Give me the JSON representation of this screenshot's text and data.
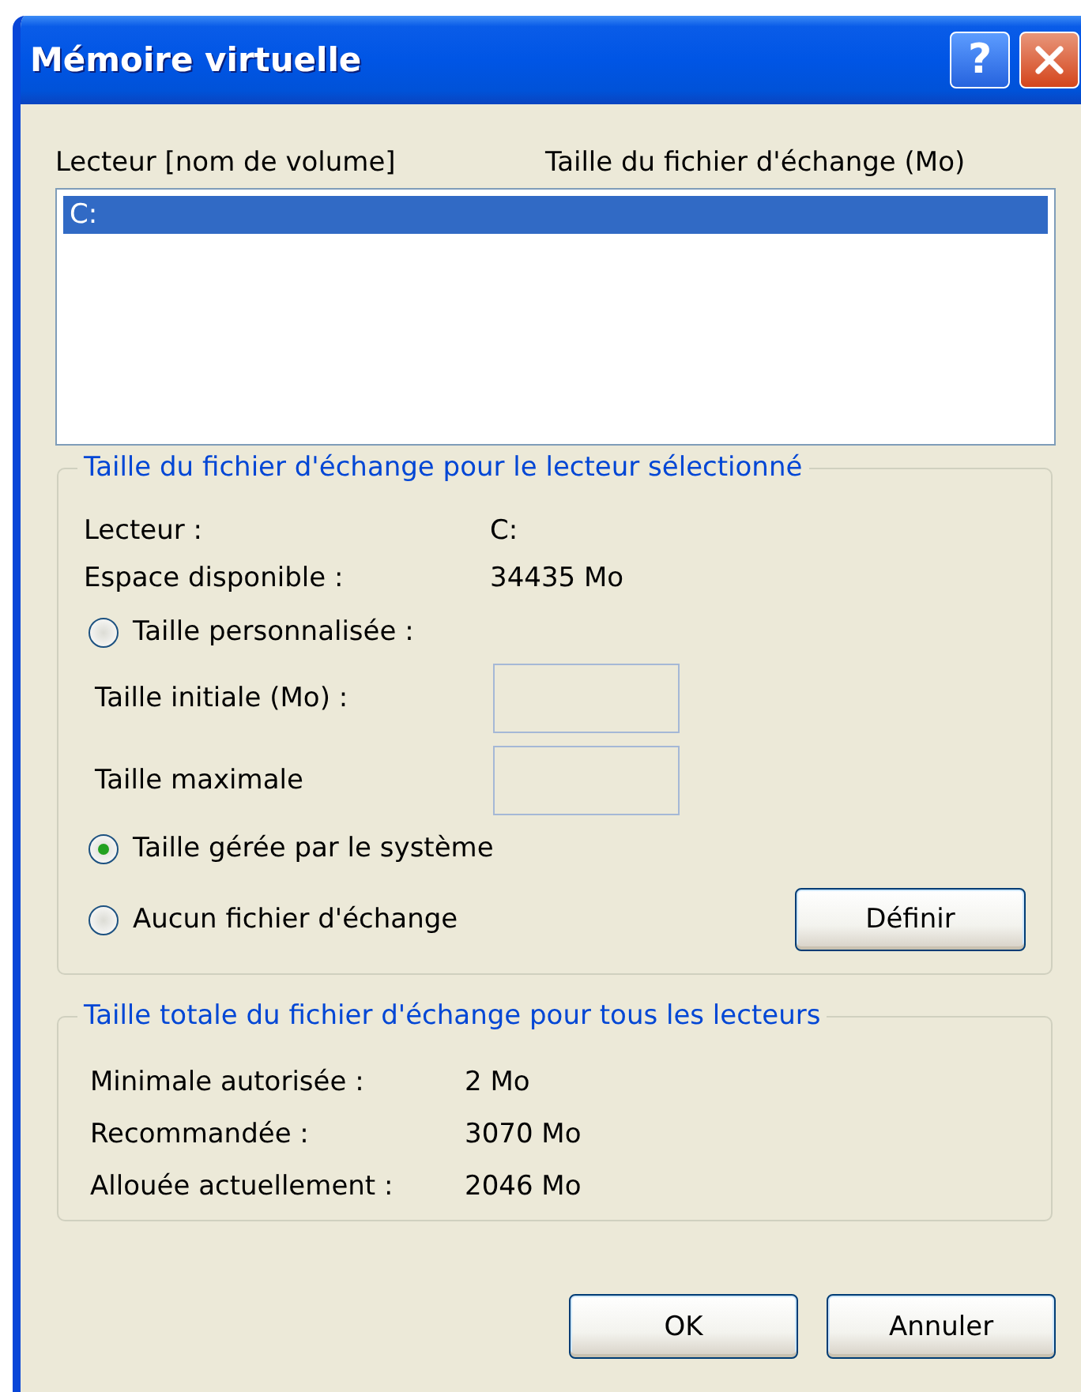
{
  "window": {
    "title": "Mémoire virtuelle",
    "title_buttons": [
      {
        "kind": "help",
        "label": "?"
      },
      {
        "kind": "close"
      }
    ]
  },
  "drive_list": {
    "columns": [
      "Lecteur [nom de volume]",
      "Taille du fichier d'échange (Mo)"
    ],
    "rows": [
      {
        "drive": "C:",
        "selected": true
      }
    ]
  },
  "selected_drive_group": {
    "title": "Taille du fichier d'échange pour le lecteur sélectionné",
    "info": [
      {
        "label": "Lecteur :",
        "value": "C:"
      },
      {
        "label": "Espace disponible :",
        "value": "34435 Mo"
      }
    ],
    "options": [
      {
        "label": "Taille personnalisée :",
        "selected": false
      },
      {
        "label": "Taille gérée par le système",
        "selected": true
      },
      {
        "label": "Aucun fichier d'échange",
        "selected": false
      }
    ],
    "size_fields": [
      {
        "label": "Taille initiale (Mo) :"
      },
      {
        "label": "Taille maximale"
      }
    ],
    "set_button": "Définir"
  },
  "total_group": {
    "title": "Taille totale du fichier d'échange pour tous les lecteurs",
    "rows": [
      {
        "label": "Minimale autorisée :",
        "value": "2 Mo"
      },
      {
        "label": "Recommandée :",
        "value": "3070 Mo"
      },
      {
        "label": "Allouée actuellement :",
        "value": "2046 Mo"
      }
    ]
  },
  "buttons": [
    "OK",
    "Annuler"
  ]
}
